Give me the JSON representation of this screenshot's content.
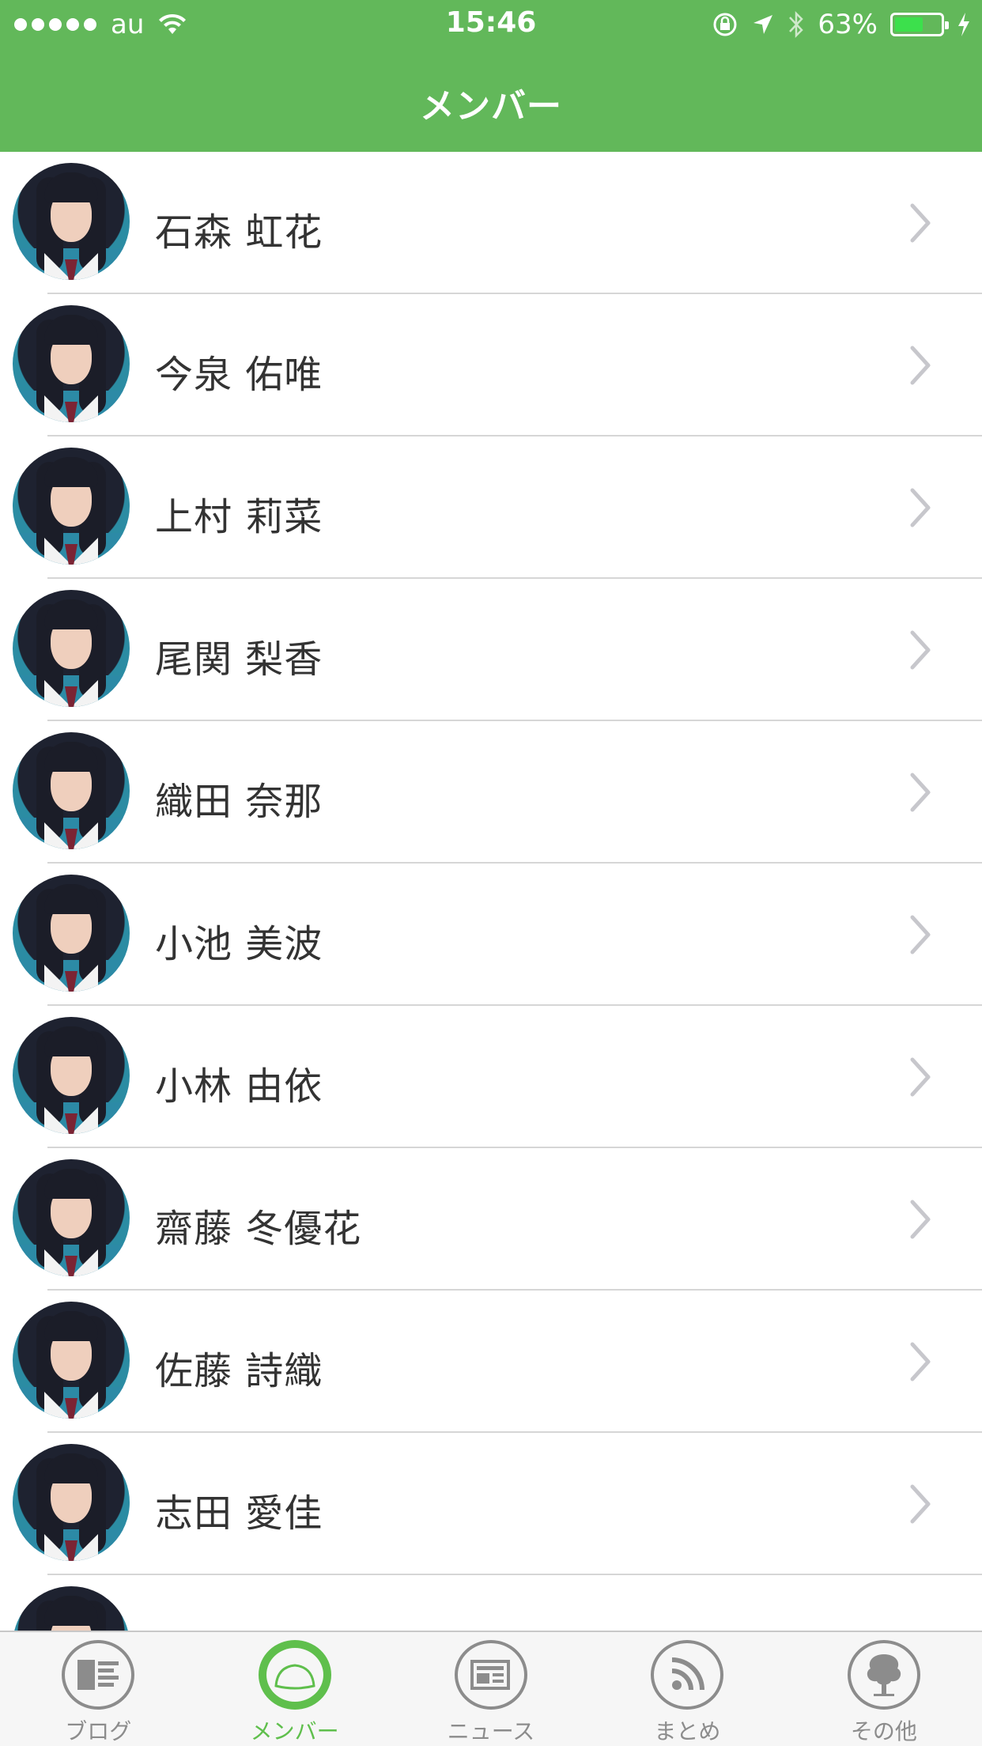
{
  "status_bar": {
    "carrier": "au",
    "time": "15:46",
    "battery": "63%",
    "battery_level": 0.63,
    "icons": [
      "signal-dots-icon",
      "wifi-icon",
      "rotation-lock-icon",
      "location-icon",
      "bluetooth-icon",
      "battery-icon",
      "charging-icon"
    ]
  },
  "nav": {
    "title": "メンバー"
  },
  "members": [
    {
      "name": "石森 虹花"
    },
    {
      "name": "今泉 佑唯"
    },
    {
      "name": "上村 莉菜"
    },
    {
      "name": "尾関 梨香"
    },
    {
      "name": "織田 奈那"
    },
    {
      "name": "小池 美波"
    },
    {
      "name": "小林 由依"
    },
    {
      "name": "齋藤 冬優花"
    },
    {
      "name": "佐藤 詩織"
    },
    {
      "name": "志田 愛佳"
    },
    {
      "name": ""
    }
  ],
  "tabs": [
    {
      "label": "ブログ",
      "icon": "blog-icon",
      "active": false
    },
    {
      "label": "メンバー",
      "icon": "member-icon",
      "active": true
    },
    {
      "label": "ニュース",
      "icon": "news-icon",
      "active": false
    },
    {
      "label": "まとめ",
      "icon": "rss-icon",
      "active": false
    },
    {
      "label": "その他",
      "icon": "tree-icon",
      "active": false
    }
  ],
  "colors": {
    "accent": "#62b85a",
    "active_tab": "#5fbf4c",
    "inactive_tab": "#8c8c8c",
    "battery_fill": "#3ce04c"
  }
}
